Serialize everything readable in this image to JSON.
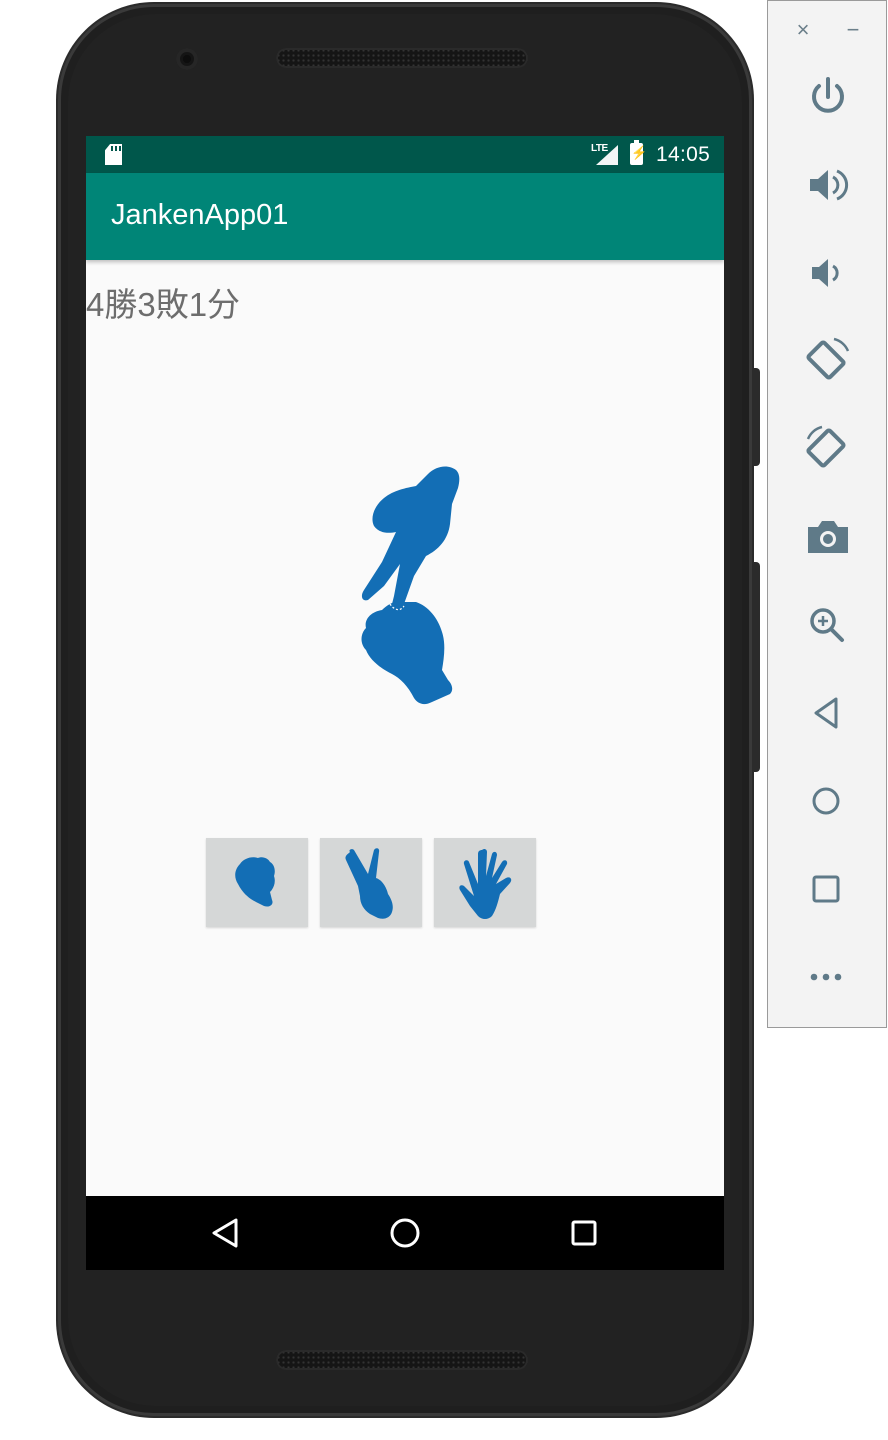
{
  "app": {
    "title": "JankenApp01",
    "score_text": "4勝3敗1分"
  },
  "status_bar": {
    "time": "14:05",
    "network": "LTE",
    "icons": [
      "sd-card-icon",
      "signal-icon",
      "battery-charging-icon"
    ]
  },
  "result_image": {
    "icon": "hands-scissors-vs-rock-icon"
  },
  "choices": [
    {
      "icon": "rock-hand-icon",
      "meaning": "rock"
    },
    {
      "icon": "scissors-hand-icon",
      "meaning": "scissors"
    },
    {
      "icon": "paper-hand-icon",
      "meaning": "paper"
    }
  ],
  "nav_bar": [
    "back-icon",
    "home-icon",
    "recents-icon"
  ],
  "emulator_panel": {
    "window_controls": [
      "close-icon",
      "minimize-icon"
    ],
    "close_glyph": "×",
    "minimize_glyph": "−",
    "controls": [
      "power-icon",
      "volume-up-icon",
      "volume-down-icon",
      "rotate-left-icon",
      "rotate-right-icon",
      "screenshot-icon",
      "zoom-icon",
      "back-icon",
      "home-icon",
      "overview-icon",
      "more-icon"
    ]
  },
  "colors": {
    "status_bar": "#00574b",
    "app_bar": "#008577",
    "hand_blue": "#136eb5",
    "button_gray": "#d5d7d7",
    "score_text": "#6d6d6d",
    "panel_icon": "#5f7a88"
  }
}
